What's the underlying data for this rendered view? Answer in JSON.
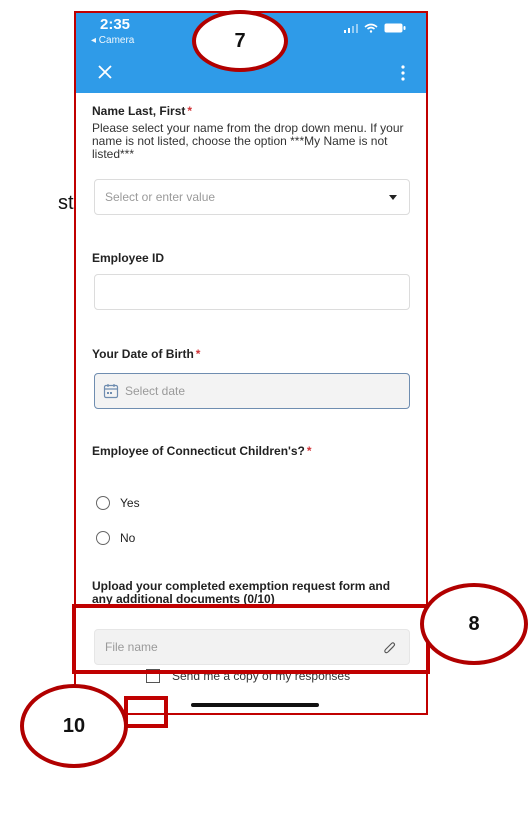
{
  "doc_fragment": "st",
  "status_bar": {
    "time": "2:35",
    "back_app": "◂ Camera"
  },
  "header": {
    "close_icon": "close-icon",
    "menu_icon": "more-vertical-icon",
    "accent": "#2f9be8"
  },
  "questions": {
    "name": {
      "title": "Name Last, First",
      "required_mark": "*",
      "description": "Please select your name from the drop down menu. If your name is not listed, choose the option ***My Name is not listed***",
      "placeholder": "Select or enter value"
    },
    "employee_id": {
      "title": "Employee ID"
    },
    "dob": {
      "title": "Your Date of Birth",
      "required_mark": "*",
      "placeholder": "Select date"
    },
    "employee_cc": {
      "title": "Employee of Connecticut Children's?",
      "required_mark": "*",
      "options": [
        "Yes",
        "No"
      ]
    },
    "upload": {
      "title": "Upload your completed exemption request form and any additional documents (0/10)",
      "placeholder": "File name"
    }
  },
  "copy_responses": "Send me a copy of my responses",
  "annotations": {
    "seven": "7",
    "eight": "8",
    "ten": "10",
    "color": "#c00000"
  }
}
